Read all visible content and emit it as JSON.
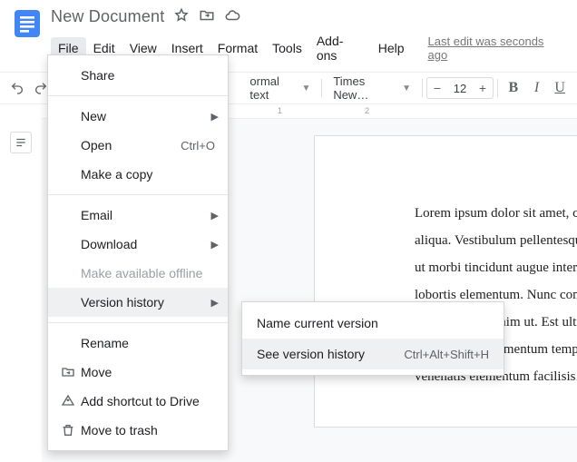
{
  "doc": {
    "title": "New Document"
  },
  "menubar": {
    "items": [
      "File",
      "Edit",
      "View",
      "Insert",
      "Format",
      "Tools",
      "Add-ons",
      "Help"
    ],
    "last_edit": "Last edit was seconds ago"
  },
  "toolbar": {
    "style_select": "ormal text",
    "font_select": "Times New…",
    "font_size": "12"
  },
  "ruler": {
    "t1": "1",
    "t2": "2"
  },
  "page_text": "Lorem ipsum dolor sit amet, consectetur labore et dolore magna aliqua. Vestibulum pellentesque pulvinar pellentesque habitant. At ut morbi tincidunt augue interdum ipsum nunc. Tempor orci eu lobortis elementum. Nunc consequat suspendisse sed tempus quam. Urna porttitor enim ut. Est ultricies pharetra massa massa ultricies. In massa sed elementum tempus egestas. Consequat id porta nibh venenatis elementum facilisis leo vel. Velit euismod.",
  "file_menu": {
    "share": "Share",
    "new": "New",
    "open": "Open",
    "open_shortcut": "Ctrl+O",
    "make_copy": "Make a copy",
    "email": "Email",
    "download": "Download",
    "make_offline": "Make available offline",
    "version_history": "Version history",
    "rename": "Rename",
    "move": "Move",
    "add_shortcut": "Add shortcut to Drive",
    "move_to_trash": "Move to trash"
  },
  "version_submenu": {
    "name_current": "Name current version",
    "see_history": "See version history",
    "see_history_shortcut": "Ctrl+Alt+Shift+H"
  }
}
